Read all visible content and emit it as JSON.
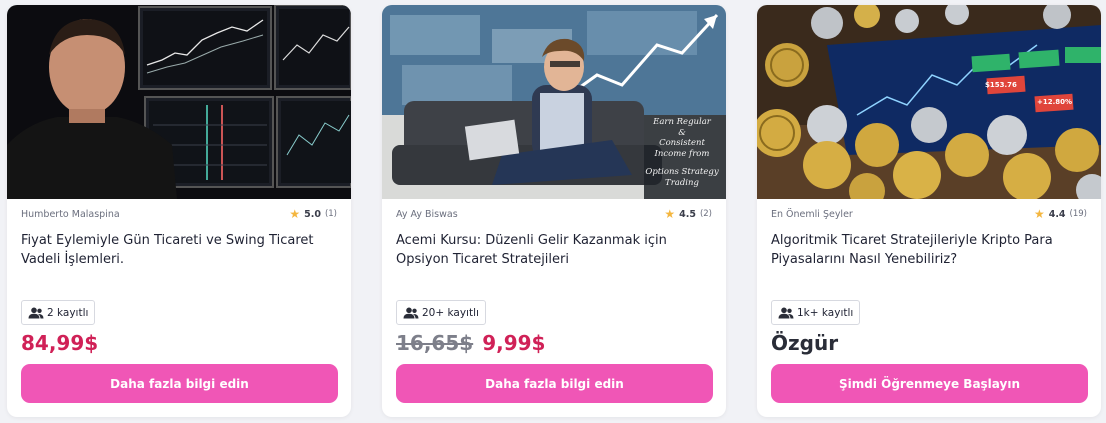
{
  "colors": {
    "price": "#d02157",
    "button": "#f056b6",
    "star": "#f4b63f",
    "page_background": "#f1f2f6"
  },
  "cards": [
    {
      "author": "Humberto Malaspina",
      "rating": "5.0",
      "rating_count": "(1)",
      "title": "Fiyat Eylemiyle Gün Ticareti ve Swing Ticaret Vadeli İşlemleri.",
      "enrolled": "2 kayıtlı",
      "price": "84,99$",
      "button": "Daha fazla bilgi edin",
      "thumbnail": "man-at-trading-desk-with-chart-monitors"
    },
    {
      "author": "Ay Ay Biswas",
      "rating": "4.5",
      "rating_count": "(2)",
      "title": "Acemi Kursu: Düzenli Gelir Kazanmak için Opsiyon Ticaret Stratejileri",
      "enrolled": "20+ kayıtlı",
      "old_price": "16,65$",
      "price": "9,99$",
      "button": "Daha fazla bilgi edin",
      "thumbnail": "man-on-sofa-with-laptop",
      "thumbnail_text": [
        "Earn Regular",
        "&",
        "Consistent",
        "Income from",
        "",
        "Options Strategy",
        "Trading"
      ]
    },
    {
      "author": "En Önemli Şeyler",
      "rating": "4.4",
      "rating_count": "(19)",
      "title": "Algoritmik Ticaret Stratejileriyle Kripto Para Piyasalarını Nasıl Yenebiliriz?",
      "enrolled": "1k+ kayıtlı",
      "price": "Özgür",
      "button": "Şimdi Öğrenmeye Başlayın",
      "thumbnail": "crypto-coins-on-trading-screen",
      "thumbnail_text": [
        "$153.76",
        "+12.80%"
      ]
    }
  ]
}
